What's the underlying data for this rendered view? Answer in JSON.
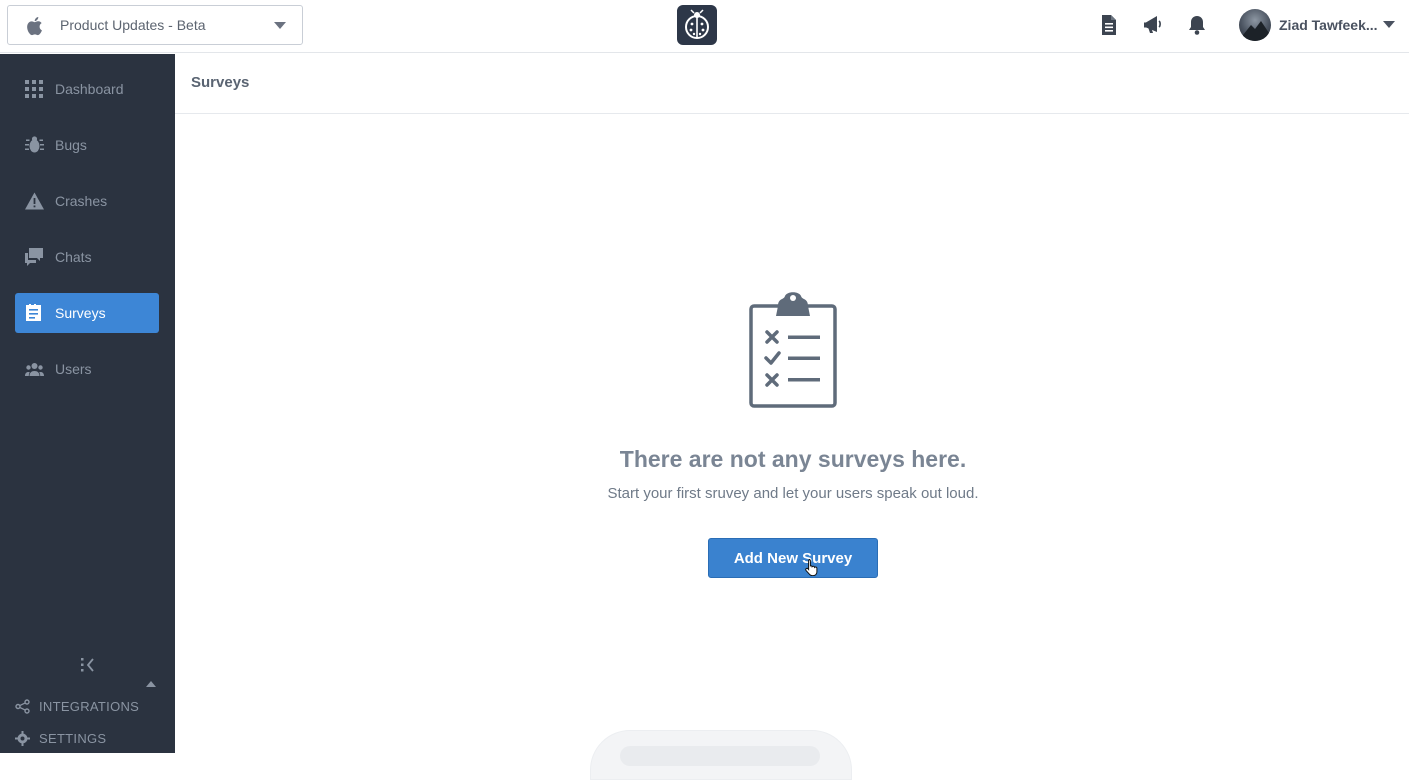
{
  "topbar": {
    "app_selector": {
      "label": "Product Updates - Beta"
    },
    "user": {
      "name": "Ziad Tawfeek..."
    }
  },
  "sidebar": {
    "items": [
      {
        "label": "Dashboard",
        "icon": "grid-icon"
      },
      {
        "label": "Bugs",
        "icon": "bug-icon"
      },
      {
        "label": "Crashes",
        "icon": "warning-icon"
      },
      {
        "label": "Chats",
        "icon": "chat-icon"
      },
      {
        "label": "Surveys",
        "icon": "survey-icon",
        "active": true
      },
      {
        "label": "Users",
        "icon": "users-icon"
      }
    ],
    "integrations_label": "INTEGRATIONS",
    "settings_label": "SETTINGS"
  },
  "main": {
    "title": "Surveys",
    "empty_state": {
      "title": "There are not any surveys here.",
      "subtitle": "Start your first sruvey and let your users speak out loud.",
      "button_label": "Add New Survey",
      "icon": "clipboard-checklist-icon"
    }
  },
  "colors": {
    "sidebar_bg": "#2b3340",
    "accent": "#3d86d6",
    "button": "#3a82cf",
    "muted_text": "#8a94a2"
  }
}
